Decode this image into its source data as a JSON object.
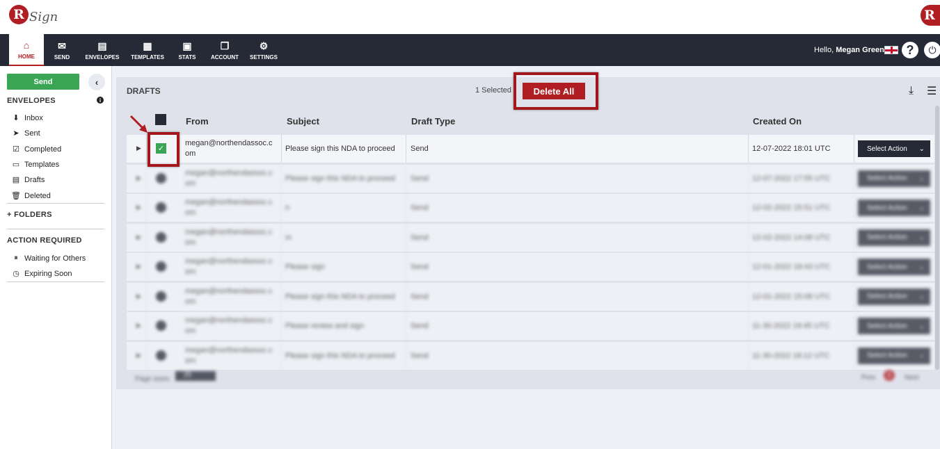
{
  "app": {
    "logo_letter": "R",
    "logo_word": "Sign"
  },
  "nav": {
    "items": [
      {
        "label": "HOME",
        "icon": "home-icon",
        "glyph": "⌂"
      },
      {
        "label": "SEND",
        "icon": "envelope-icon",
        "glyph": "✉"
      },
      {
        "label": "ENVELOPES",
        "icon": "inbox-icon",
        "glyph": "▤"
      },
      {
        "label": "TEMPLATES",
        "icon": "template-icon",
        "glyph": "▦"
      },
      {
        "label": "STATS",
        "icon": "briefcase-icon",
        "glyph": "▣"
      },
      {
        "label": "ACCOUNT",
        "icon": "document-icon",
        "glyph": "❐"
      },
      {
        "label": "SETTINGS",
        "icon": "gear-icon",
        "glyph": "⚙"
      }
    ],
    "hello_prefix": "Hello, ",
    "user_name": "Megan Greene"
  },
  "sidebar": {
    "send_label": "Send",
    "envelopes_title": "ENVELOPES",
    "envelope_items": [
      {
        "label": "Inbox",
        "icon": "inbox-icon",
        "glyph": "⬇"
      },
      {
        "label": "Sent",
        "icon": "paper-plane-icon",
        "glyph": "➤"
      },
      {
        "label": "Completed",
        "icon": "checkbox-icon",
        "glyph": "☑"
      },
      {
        "label": "Templates",
        "icon": "template-icon",
        "glyph": "▭"
      },
      {
        "label": "Drafts",
        "icon": "drafts-icon",
        "glyph": "▤"
      },
      {
        "label": "Deleted",
        "icon": "trash-icon",
        "glyph": "🗑"
      }
    ],
    "folders_label": "FOLDERS",
    "action_required_title": "ACTION REQUIRED",
    "action_items": [
      {
        "label": "Waiting for Others",
        "icon": "pause-icon",
        "glyph": "⏸"
      },
      {
        "label": "Expiring Soon",
        "icon": "clock-icon",
        "glyph": "◷"
      }
    ]
  },
  "drafts": {
    "title": "DRAFTS",
    "selected_text": "1 Selected",
    "delete_all_label": "Delete All",
    "columns": {
      "from": "From",
      "subject": "Subject",
      "draft_type": "Draft Type",
      "created_on": "Created On"
    },
    "rows": [
      {
        "from": "megan@northendassoc.com",
        "subject": "Please sign this NDA to proceed",
        "draft_type": "Send",
        "created_on": "12-07-2022 18:01 UTC",
        "action": "Select Action",
        "checked": true
      },
      {
        "from": "megan@northendassoc.com",
        "subject": "Please sign this NDA to proceed",
        "draft_type": "Send",
        "created_on": "12-07-2022 17:55 UTC",
        "action": "Select Action",
        "checked": false
      },
      {
        "from": "megan@northendassoc.com",
        "subject": "n",
        "draft_type": "Send",
        "created_on": "12-02-2022 15:51 UTC",
        "action": "Select Action",
        "checked": false
      },
      {
        "from": "megan@northendassoc.com",
        "subject": "m",
        "draft_type": "Send",
        "created_on": "12-02-2022 14:08 UTC",
        "action": "Select Action",
        "checked": false
      },
      {
        "from": "megan@northendassoc.com",
        "subject": "Please sign",
        "draft_type": "Send",
        "created_on": "12-01-2022 18:43 UTC",
        "action": "Select Action",
        "checked": false
      },
      {
        "from": "megan@northendassoc.com",
        "subject": "Please sign this NDA to proceed",
        "draft_type": "Send",
        "created_on": "12-01-2022 15:08 UTC",
        "action": "Select Action",
        "checked": false
      },
      {
        "from": "megan@northendassoc.com",
        "subject": "Please review and sign",
        "draft_type": "Send",
        "created_on": "11-30-2022 19:45 UTC",
        "action": "Select Action",
        "checked": false
      },
      {
        "from": "megan@northendassoc.com",
        "subject": "Please sign this NDA to proceed",
        "draft_type": "Send",
        "created_on": "11-30-2022 18:12 UTC",
        "action": "Select Action",
        "checked": false
      }
    ],
    "page_sizes_label": "Page sizes:",
    "page_size_value": "25",
    "prev_label": "Prev",
    "current_page": "1",
    "next_label": "Next"
  },
  "colors": {
    "brand_red": "#b01e23",
    "nav_dark": "#262a36",
    "send_green": "#3aa655"
  }
}
